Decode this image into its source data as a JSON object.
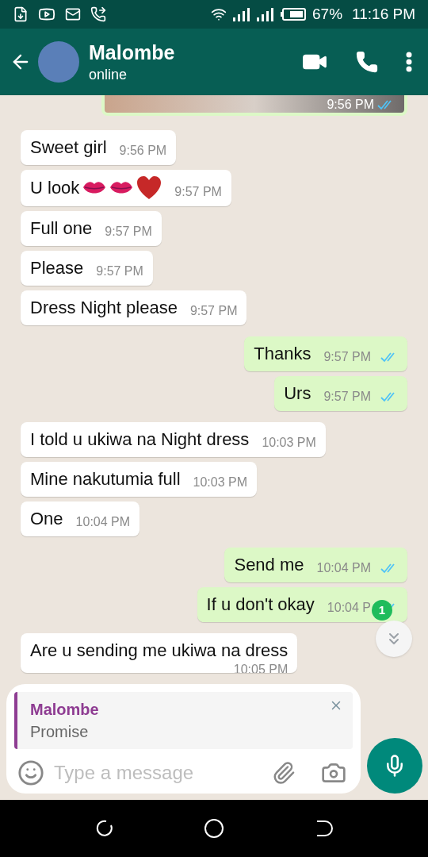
{
  "status_bar": {
    "battery": "67%",
    "time": "11:16 PM"
  },
  "header": {
    "name": "Malombe",
    "status": "online"
  },
  "messages": [
    {
      "kind": "photo",
      "time": "9:56 PM",
      "read": true
    },
    {
      "kind": "received",
      "text": "Sweet girl",
      "time": "9:56 PM"
    },
    {
      "kind": "received",
      "text": "U look",
      "emojis": [
        {
          "kind": "lips"
        },
        {
          "kind": "lips"
        },
        {
          "kind": "heart"
        }
      ],
      "time": "9:57 PM"
    },
    {
      "kind": "received",
      "text": "Full one",
      "time": "9:57 PM"
    },
    {
      "kind": "received",
      "text": "Please",
      "time": "9:57 PM"
    },
    {
      "kind": "received",
      "text": "Dress Night please",
      "time": "9:57 PM"
    },
    {
      "kind": "sent",
      "text": "Thanks",
      "time": "9:57 PM",
      "read": true
    },
    {
      "kind": "sent",
      "text": "Urs",
      "time": "9:57 PM",
      "read": true
    },
    {
      "kind": "received",
      "text": "I told u ukiwa na Night dress",
      "time": "10:03 PM"
    },
    {
      "kind": "received",
      "text": "Mine nakutumia full",
      "time": "10:03 PM"
    },
    {
      "kind": "received",
      "text": "One",
      "time": "10:04 PM"
    },
    {
      "kind": "sent",
      "text": "Send me",
      "time": "10:04 PM",
      "read": true
    },
    {
      "kind": "sent",
      "text": "If u don't okay",
      "time": "10:04 P",
      "read": true
    },
    {
      "kind": "received_cut",
      "text": "Are u sending me ukiwa na dress",
      "time": "10:05 PM"
    }
  ],
  "scroll_button": {
    "badge": "1"
  },
  "reply": {
    "author": "Malombe",
    "text": "Promise"
  },
  "composer": {
    "placeholder": "Type a message"
  }
}
